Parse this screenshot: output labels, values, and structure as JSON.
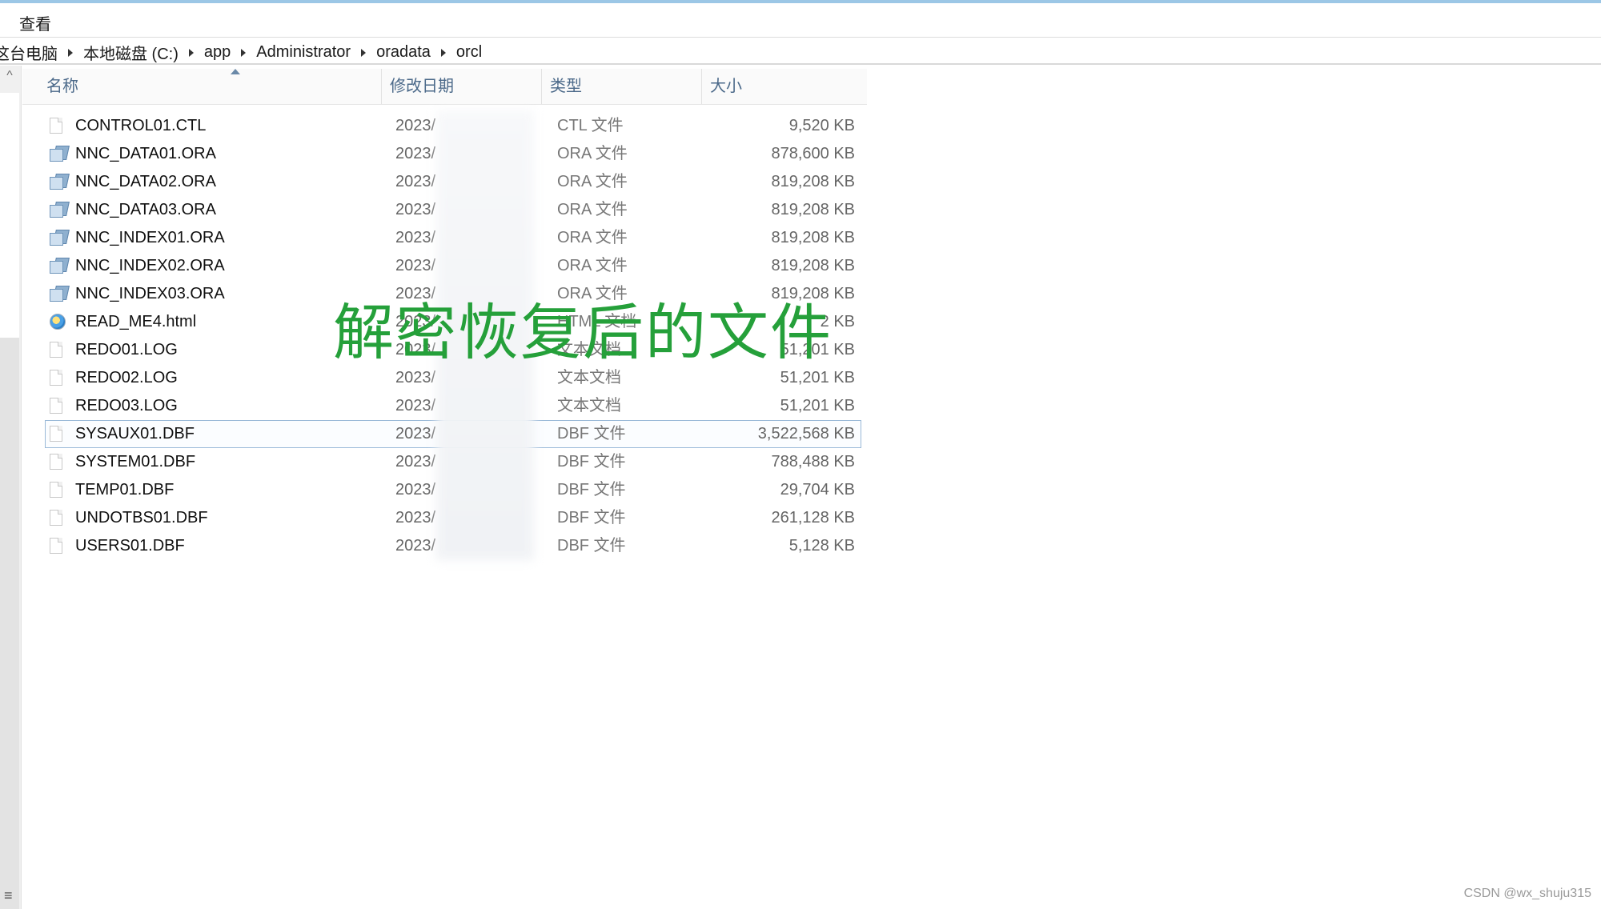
{
  "menu": {
    "view_label": "查看"
  },
  "breadcrumb": [
    "这台电脑",
    "本地磁盘 (C:)",
    "app",
    "Administrator",
    "oradata",
    "orcl"
  ],
  "columns": {
    "name": "名称",
    "date": "修改日期",
    "type": "类型",
    "size": "大小"
  },
  "files": [
    {
      "name": "CONTROL01.CTL",
      "date": "2023/",
      "type": "CTL 文件",
      "size": "9,520 KB",
      "icon": "document-icon"
    },
    {
      "name": "NNC_DATA01.ORA",
      "date": "2023/",
      "type": "ORA 文件",
      "size": "878,600 KB",
      "icon": "ora-file-icon"
    },
    {
      "name": "NNC_DATA02.ORA",
      "date": "2023/",
      "type": "ORA 文件",
      "size": "819,208 KB",
      "icon": "ora-file-icon"
    },
    {
      "name": "NNC_DATA03.ORA",
      "date": "2023/",
      "type": "ORA 文件",
      "size": "819,208 KB",
      "icon": "ora-file-icon"
    },
    {
      "name": "NNC_INDEX01.ORA",
      "date": "2023/",
      "type": "ORA 文件",
      "size": "819,208 KB",
      "icon": "ora-file-icon"
    },
    {
      "name": "NNC_INDEX02.ORA",
      "date": "2023/",
      "type": "ORA 文件",
      "size": "819,208 KB",
      "icon": "ora-file-icon"
    },
    {
      "name": "NNC_INDEX03.ORA",
      "date": "2023/",
      "type": "ORA 文件",
      "size": "819,208 KB",
      "icon": "ora-file-icon"
    },
    {
      "name": "READ_ME4.html",
      "date": "2023/",
      "type": "HTML 文档",
      "size": "2 KB",
      "icon": "html-file-icon"
    },
    {
      "name": "REDO01.LOG",
      "date": "2023/",
      "type": "文本文档",
      "size": "51,201 KB",
      "icon": "document-icon"
    },
    {
      "name": "REDO02.LOG",
      "date": "2023/",
      "type": "文本文档",
      "size": "51,201 KB",
      "icon": "document-icon"
    },
    {
      "name": "REDO03.LOG",
      "date": "2023/",
      "type": "文本文档",
      "size": "51,201 KB",
      "icon": "document-icon"
    },
    {
      "name": "SYSAUX01.DBF",
      "date": "2023/",
      "type": "DBF 文件",
      "size": "3,522,568 KB",
      "icon": "document-icon",
      "selected": true
    },
    {
      "name": "SYSTEM01.DBF",
      "date": "2023/",
      "type": "DBF 文件",
      "size": "788,488 KB",
      "icon": "document-icon"
    },
    {
      "name": "TEMP01.DBF",
      "date": "2023/",
      "type": "DBF 文件",
      "size": "29,704 KB",
      "icon": "document-icon"
    },
    {
      "name": "UNDOTBS01.DBF",
      "date": "2023/",
      "type": "DBF 文件",
      "size": "261,128 KB",
      "icon": "document-icon"
    },
    {
      "name": "USERS01.DBF",
      "date": "2023/",
      "type": "DBF 文件",
      "size": "5,128 KB",
      "icon": "document-icon"
    }
  ],
  "overlay_text": "解密恢复后的文件",
  "watermark": "CSDN @wx_shuju315",
  "colors": {
    "overlay": "#25a03a",
    "header_text": "#4c6a8a",
    "selection_border": "#9ab9d8"
  }
}
